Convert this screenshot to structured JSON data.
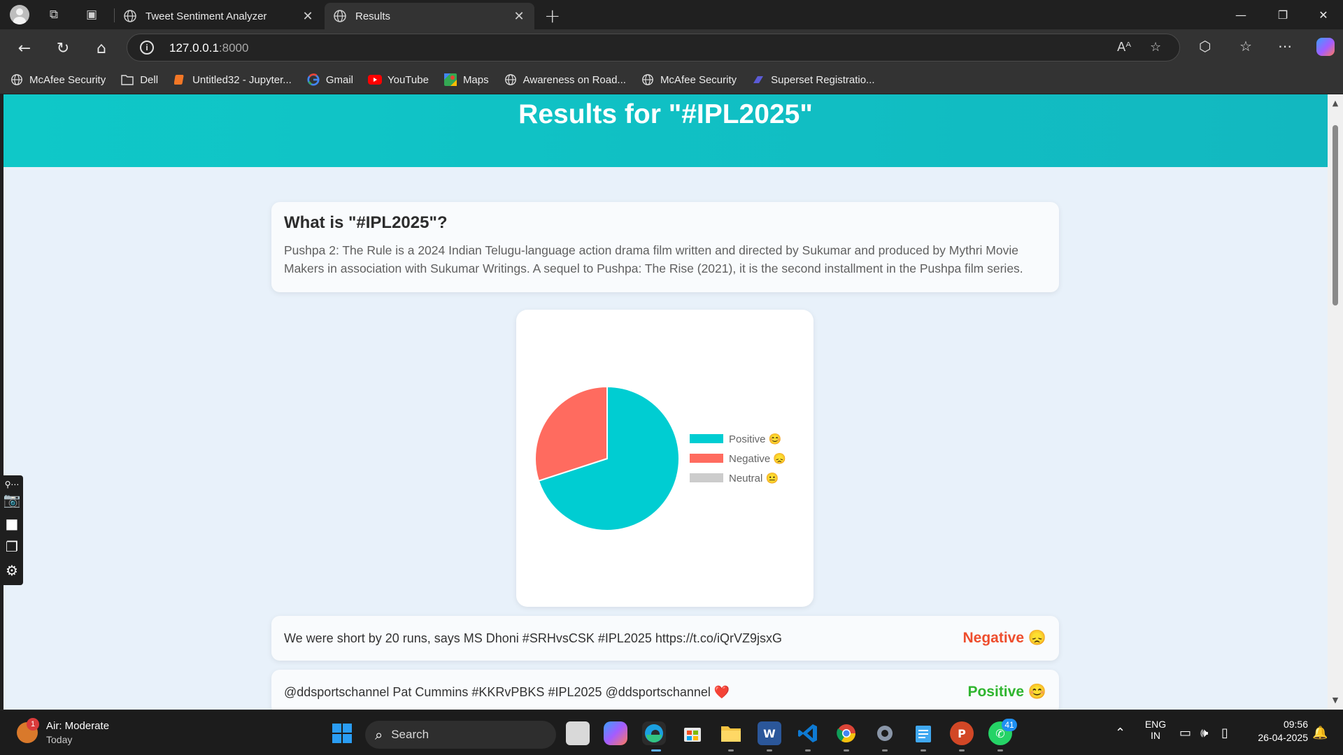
{
  "browser": {
    "tabs": [
      {
        "title": "Tweet Sentiment Analyzer",
        "active": false
      },
      {
        "title": "Results",
        "active": true
      }
    ],
    "address": {
      "host": "127.0.0.1",
      "port": ":8000"
    },
    "bookmarks": [
      {
        "label": "McAfee Security",
        "icon": "globe-icon"
      },
      {
        "label": "Dell",
        "icon": "folder-icon"
      },
      {
        "label": "Untitled32 - Jupyter...",
        "icon": "jupyter-icon"
      },
      {
        "label": "Gmail",
        "icon": "google-icon"
      },
      {
        "label": "YouTube",
        "icon": "youtube-icon"
      },
      {
        "label": "Maps",
        "icon": "maps-icon"
      },
      {
        "label": "Awareness on Road...",
        "icon": "globe-icon"
      },
      {
        "label": "McAfee Security",
        "icon": "globe-icon"
      },
      {
        "label": "Superset Registratio...",
        "icon": "superset-icon"
      }
    ]
  },
  "page": {
    "heading": "Results for \"#IPL2025\"",
    "about": {
      "title": "What is \"#IPL2025\"?",
      "description": "Pushpa 2: The Rule is a 2024 Indian Telugu-language action drama film written and directed by Sukumar and produced by Mythri Movie Makers in association with Sukumar Writings. A sequel to Pushpa: The Rise (2021), it is the second installment in the Pushpa film series."
    },
    "tweets": [
      {
        "text": "We were short by 20 runs, says MS Dhoni #SRHvsCSK #IPL2025 https://t.co/iQrVZ9jsxG",
        "label": "Negative 😞",
        "color": "#ee4d2d"
      },
      {
        "text": "@ddsportschannel Pat Cummins #KKRvPBKS #IPL2025 @ddsportschannel ❤️",
        "label": "Positive 😊",
        "color": "#2fb52f"
      }
    ]
  },
  "chart_data": {
    "type": "pie",
    "categories": [
      "Positive 😊",
      "Negative 😞",
      "Neutral 😐"
    ],
    "values": [
      70,
      30,
      0
    ],
    "colors": [
      "#00cdd2",
      "#ff6b5f",
      "#cccccc"
    ],
    "legend_position": "right"
  },
  "taskbar": {
    "weather": {
      "line1": "Air: Moderate",
      "line2": "Today",
      "badge": "1"
    },
    "search_label": "Search",
    "whatsapp_badge": "41",
    "lang": {
      "line1": "ENG",
      "line2": "IN"
    },
    "time": "09:56",
    "date": "26-04-2025"
  }
}
